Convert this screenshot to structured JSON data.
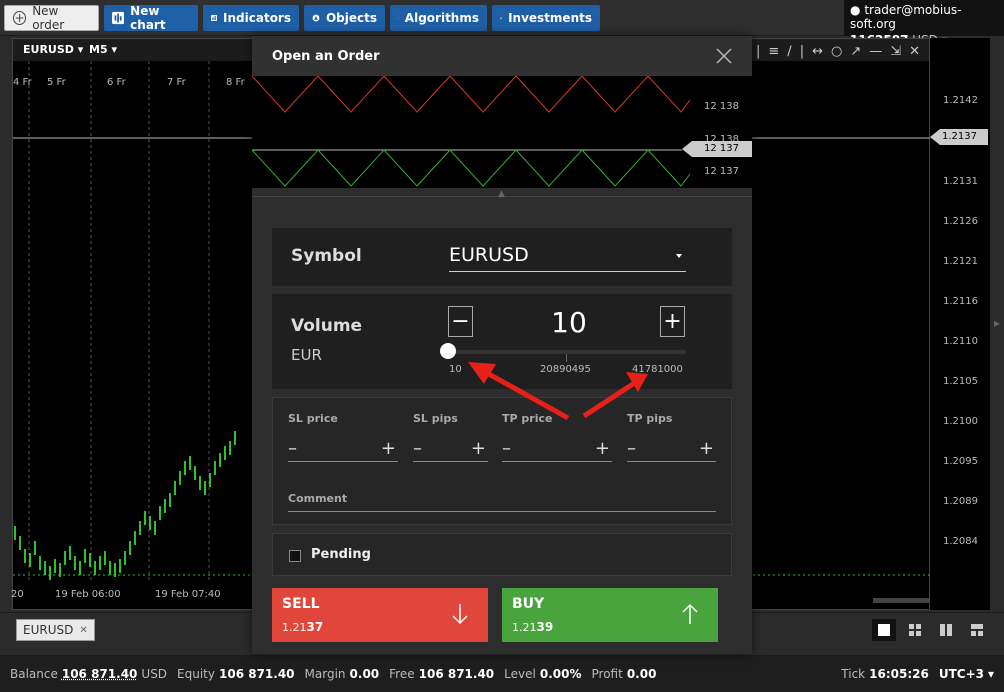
{
  "topbar": {
    "new_order": "New order",
    "new_chart": "New chart",
    "indicators": "Indicators",
    "objects": "Objects",
    "algorithms": "Algorithms",
    "investments": "Investments"
  },
  "account": {
    "user": "trader@mobius-soft.org",
    "number": "1162587",
    "currency": "USD"
  },
  "chart": {
    "symbol": "EURUSD",
    "timeframe": "M5",
    "top_dates": [
      "4 Fr",
      "5 Fr",
      "6 Fr",
      "7 Fr",
      "8 Fr"
    ],
    "bottom_dates": [
      "20",
      "19 Feb 06:00",
      "19 Feb 07:40"
    ],
    "y_ticks": [
      "1.2142",
      "1.2137",
      "1.2131",
      "1.2126",
      "1.2121",
      "1.2116",
      "1.2110",
      "1.2105",
      "1.2100",
      "1.2095",
      "1.2089",
      "1.2084"
    ],
    "current_price_tag": "1.2137"
  },
  "modal": {
    "title": "Open an Order",
    "mini_chart": {
      "labels": [
        "12 138",
        "12 138",
        "12 137"
      ],
      "tag": "12 137"
    },
    "symbol": {
      "label": "Symbol",
      "value": "EURUSD"
    },
    "volume": {
      "label": "Volume",
      "unit": "EUR",
      "value": "10",
      "minus": "−",
      "plus": "+",
      "min": "10",
      "mid": "20890495",
      "max": "41781000",
      "slider_fraction": 0.0
    },
    "fields": {
      "sl_price": "SL price",
      "sl_pips": "SL pips",
      "tp_price": "TP price",
      "tp_pips": "TP pips",
      "dash": "–",
      "plus": "+",
      "comment": "Comment"
    },
    "pending": "Pending",
    "sell": {
      "label": "SELL",
      "price_prefix": "1.21",
      "price_bold": "37"
    },
    "buy": {
      "label": "BUY",
      "price_prefix": "1.21",
      "price_bold": "39"
    }
  },
  "tabs": {
    "chip": "EURUSD",
    "close": "✕"
  },
  "status": {
    "balance_label": "Balance",
    "balance": "106 871.40",
    "balance_cur": "USD",
    "equity_label": "Equity",
    "equity": "106 871.40",
    "margin_label": "Margin",
    "margin": "0.00",
    "free_label": "Free",
    "free": "106 871.40",
    "level_label": "Level",
    "level": "0.00%",
    "profit_label": "Profit",
    "profit": "0.00",
    "tick_label": "Tick",
    "tick_time": "16:05:26",
    "timezone": "UTC+3"
  },
  "colors": {
    "sell": "#e0463a",
    "buy": "#4aa43e",
    "accent": "#1f5fa6",
    "arrow": "#e8201a"
  }
}
